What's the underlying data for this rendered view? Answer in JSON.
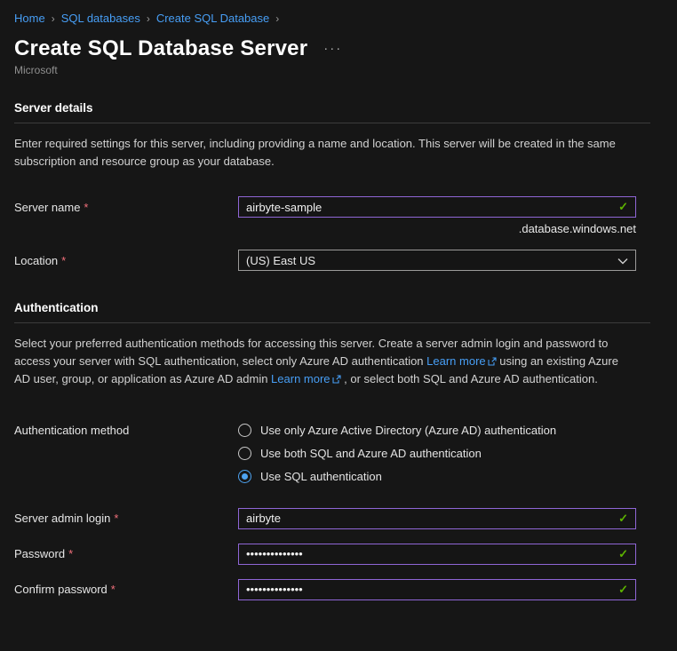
{
  "breadcrumb": {
    "separator": "›",
    "items": [
      {
        "label": "Home"
      },
      {
        "label": "SQL databases"
      },
      {
        "label": "Create SQL Database"
      }
    ]
  },
  "header": {
    "title": "Create SQL Database Server",
    "more_options": "···",
    "publisher": "Microsoft"
  },
  "server_details": {
    "heading": "Server details",
    "description": "Enter required settings for this server, including providing a name and location. This server will be created in the same subscription and resource group as your database.",
    "server_name": {
      "label": "Server name",
      "required": "*",
      "value": "airbyte-sample",
      "suffix": ".database.windows.net",
      "valid_icon": "✓"
    },
    "location": {
      "label": "Location",
      "required": "*",
      "value": "(US) East US"
    }
  },
  "authentication": {
    "heading": "Authentication",
    "description": {
      "part1": "Select your preferred authentication methods for accessing this server. Create a server admin login and password to access your server with SQL authentication, select only Azure AD authentication ",
      "learn_more_1": "Learn more",
      "part2": " using an existing Azure AD user, group, or application as Azure AD admin ",
      "learn_more_2": "Learn more",
      "part3": " , or select both SQL and Azure AD authentication."
    },
    "method": {
      "label": "Authentication method",
      "options": [
        {
          "label": "Use only Azure Active Directory (Azure AD) authentication",
          "selected": false
        },
        {
          "label": "Use both SQL and Azure AD authentication",
          "selected": false
        },
        {
          "label": "Use SQL authentication",
          "selected": true
        }
      ]
    },
    "server_admin_login": {
      "label": "Server admin login",
      "required": "*",
      "value": "airbyte",
      "valid_icon": "✓"
    },
    "password": {
      "label": "Password",
      "required": "*",
      "value": "••••••••••••••",
      "valid_icon": "✓"
    },
    "confirm_password": {
      "label": "Confirm password",
      "required": "*",
      "value": "••••••••••••••",
      "valid_icon": "✓"
    }
  },
  "colors": {
    "accent_link": "#479ef5",
    "valid_border": "#8f66d6",
    "valid_check": "#5db300",
    "required_red": "#f1707b",
    "radio_selected": "#4da2f0",
    "background": "#161616"
  }
}
